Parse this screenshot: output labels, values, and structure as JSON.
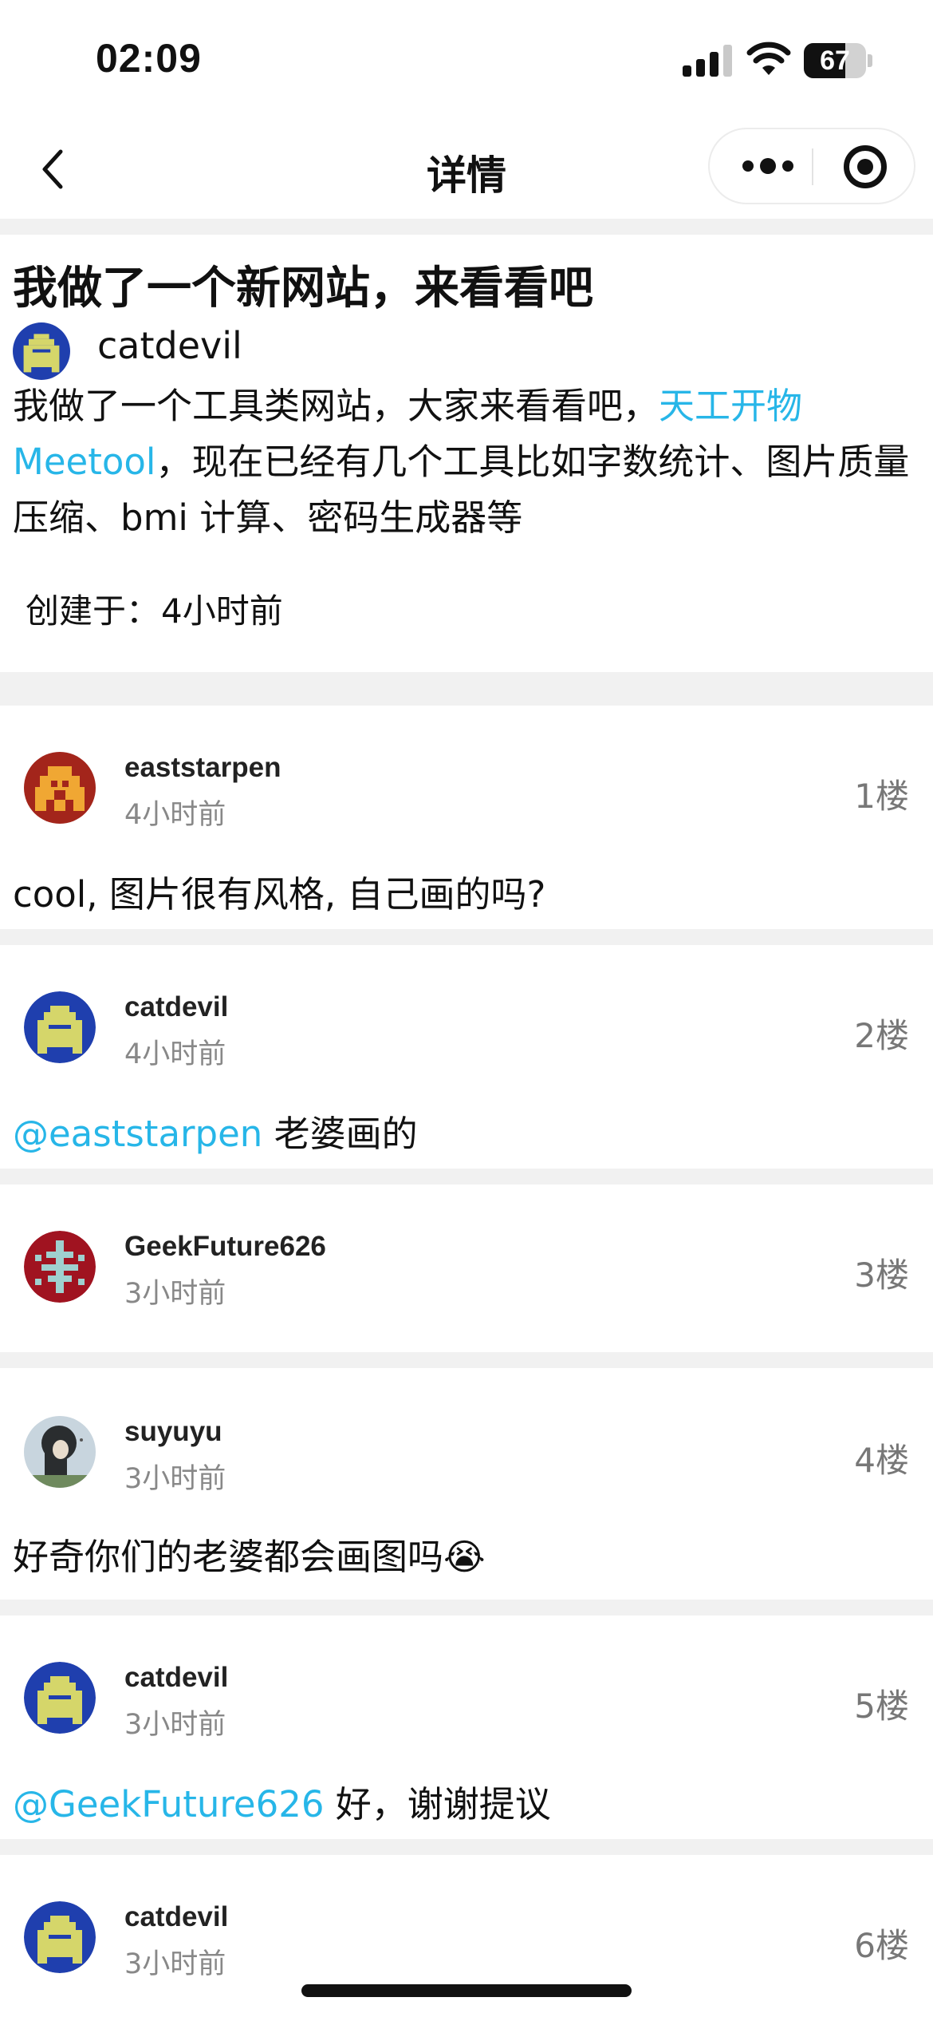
{
  "status_bar": {
    "time": "02:09",
    "battery": "67",
    "battery_level": 0.67
  },
  "nav": {
    "title": "详情"
  },
  "post": {
    "title": "我做了一个新网站，来看看吧",
    "author": "catdevil",
    "body_prefix": "我做了一个工具类网站，大家来看看吧，",
    "body_link": "天工开物 Meetool",
    "body_suffix": "，现在已经有几个工具比如字数统计、图片质量压缩、bmi 计算、密码生成器等",
    "created_label": "创建于：",
    "created_value": "4小时前"
  },
  "comments": [
    {
      "name": "eaststarpen",
      "time": "4小时前",
      "floor": "1楼",
      "mention": "",
      "text": "cool, 图片很有风格, 自己画的吗?"
    },
    {
      "name": "catdevil",
      "time": "4小时前",
      "floor": "2楼",
      "mention": "@eaststarpen",
      "text": " 老婆画的"
    },
    {
      "name": "GeekFuture626",
      "time": "3小时前",
      "floor": "3楼",
      "mention": "",
      "text": ""
    },
    {
      "name": "suyuyu",
      "time": "3小时前",
      "floor": "4楼",
      "mention": "",
      "text": "好奇你们的老婆都会画图吗😭"
    },
    {
      "name": "catdevil",
      "time": "3小时前",
      "floor": "5楼",
      "mention": "@GeekFuture626",
      "text": " 好，谢谢提议"
    },
    {
      "name": "catdevil",
      "time": "3小时前",
      "floor": "6楼",
      "mention": "",
      "text": ""
    }
  ],
  "colors": {
    "link": "#27b6e8",
    "muted": "#888888",
    "separator": "#f1f1f1"
  }
}
